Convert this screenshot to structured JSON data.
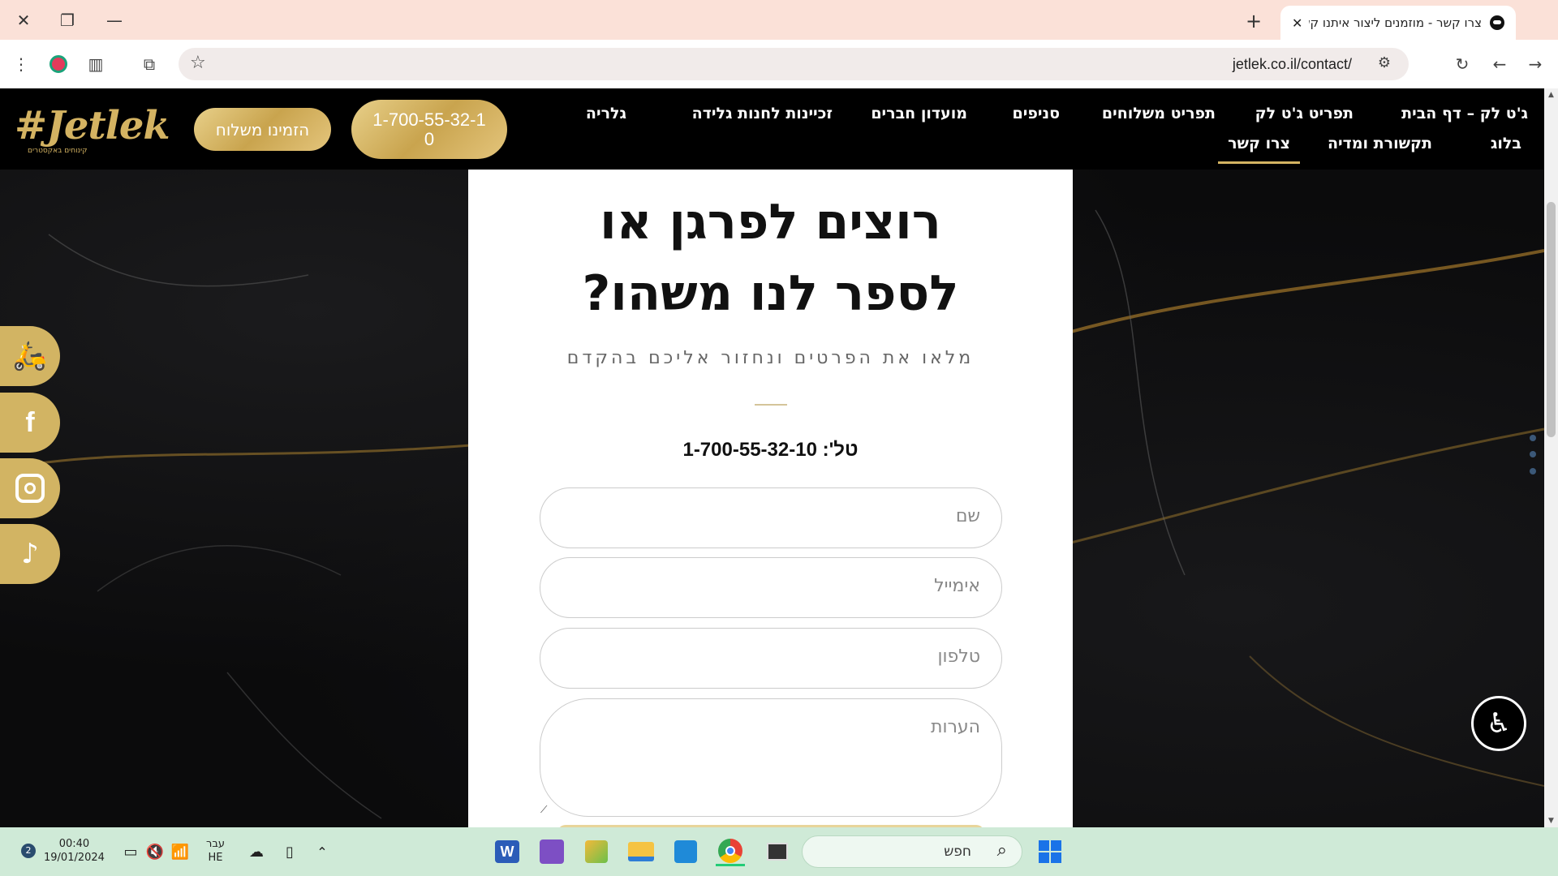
{
  "browser": {
    "tab_title": "צרו קשר - מוזמנים ליצור איתנו קשר",
    "url": "jetlek.co.il/contact/",
    "new_tab_label": "+",
    "tab_close_label": "✕"
  },
  "site": {
    "logo": "#Jetlek",
    "logo_tagline": "קינוחים באקסטרים",
    "order_button": "הזמינו משלוח",
    "phone_button": "1-700-55-32-10",
    "nav_row1": [
      "ג'ט לק – דף הבית",
      "תפריט ג'ט לק",
      "תפריט משלוחים",
      "סניפים",
      "מועדון חברים",
      "זכיינות לחנות גלידה",
      "גלריה"
    ],
    "nav_row2": [
      "בלוג",
      "תקשורת ומדיה",
      "צרו קשר"
    ],
    "active_nav": "צרו קשר"
  },
  "contact": {
    "headline_line1": "רוצים לפרגן או",
    "headline_line2": "לספר לנו משהו?",
    "subline": "מלאו את הפרטים ונחזור אליכם בהקדם",
    "phone_line": "טל': 1-700-55-32-10",
    "fields": {
      "name": "שם",
      "email": "אימייל",
      "phone": "טלפון",
      "notes": "הערות"
    }
  },
  "social_icons": [
    "scooter-icon",
    "facebook-icon",
    "instagram-icon",
    "tiktok-icon"
  ],
  "taskbar": {
    "search_placeholder": "חפש",
    "lang_top": "עבר",
    "lang_bottom": "HE",
    "time": "00:40",
    "date": "19/01/2024",
    "notification_count": "2"
  },
  "colors": {
    "gold": "#d2b463",
    "titlebar": "#fbe1d8",
    "taskbar": "#cfead7",
    "header": "#000000"
  }
}
